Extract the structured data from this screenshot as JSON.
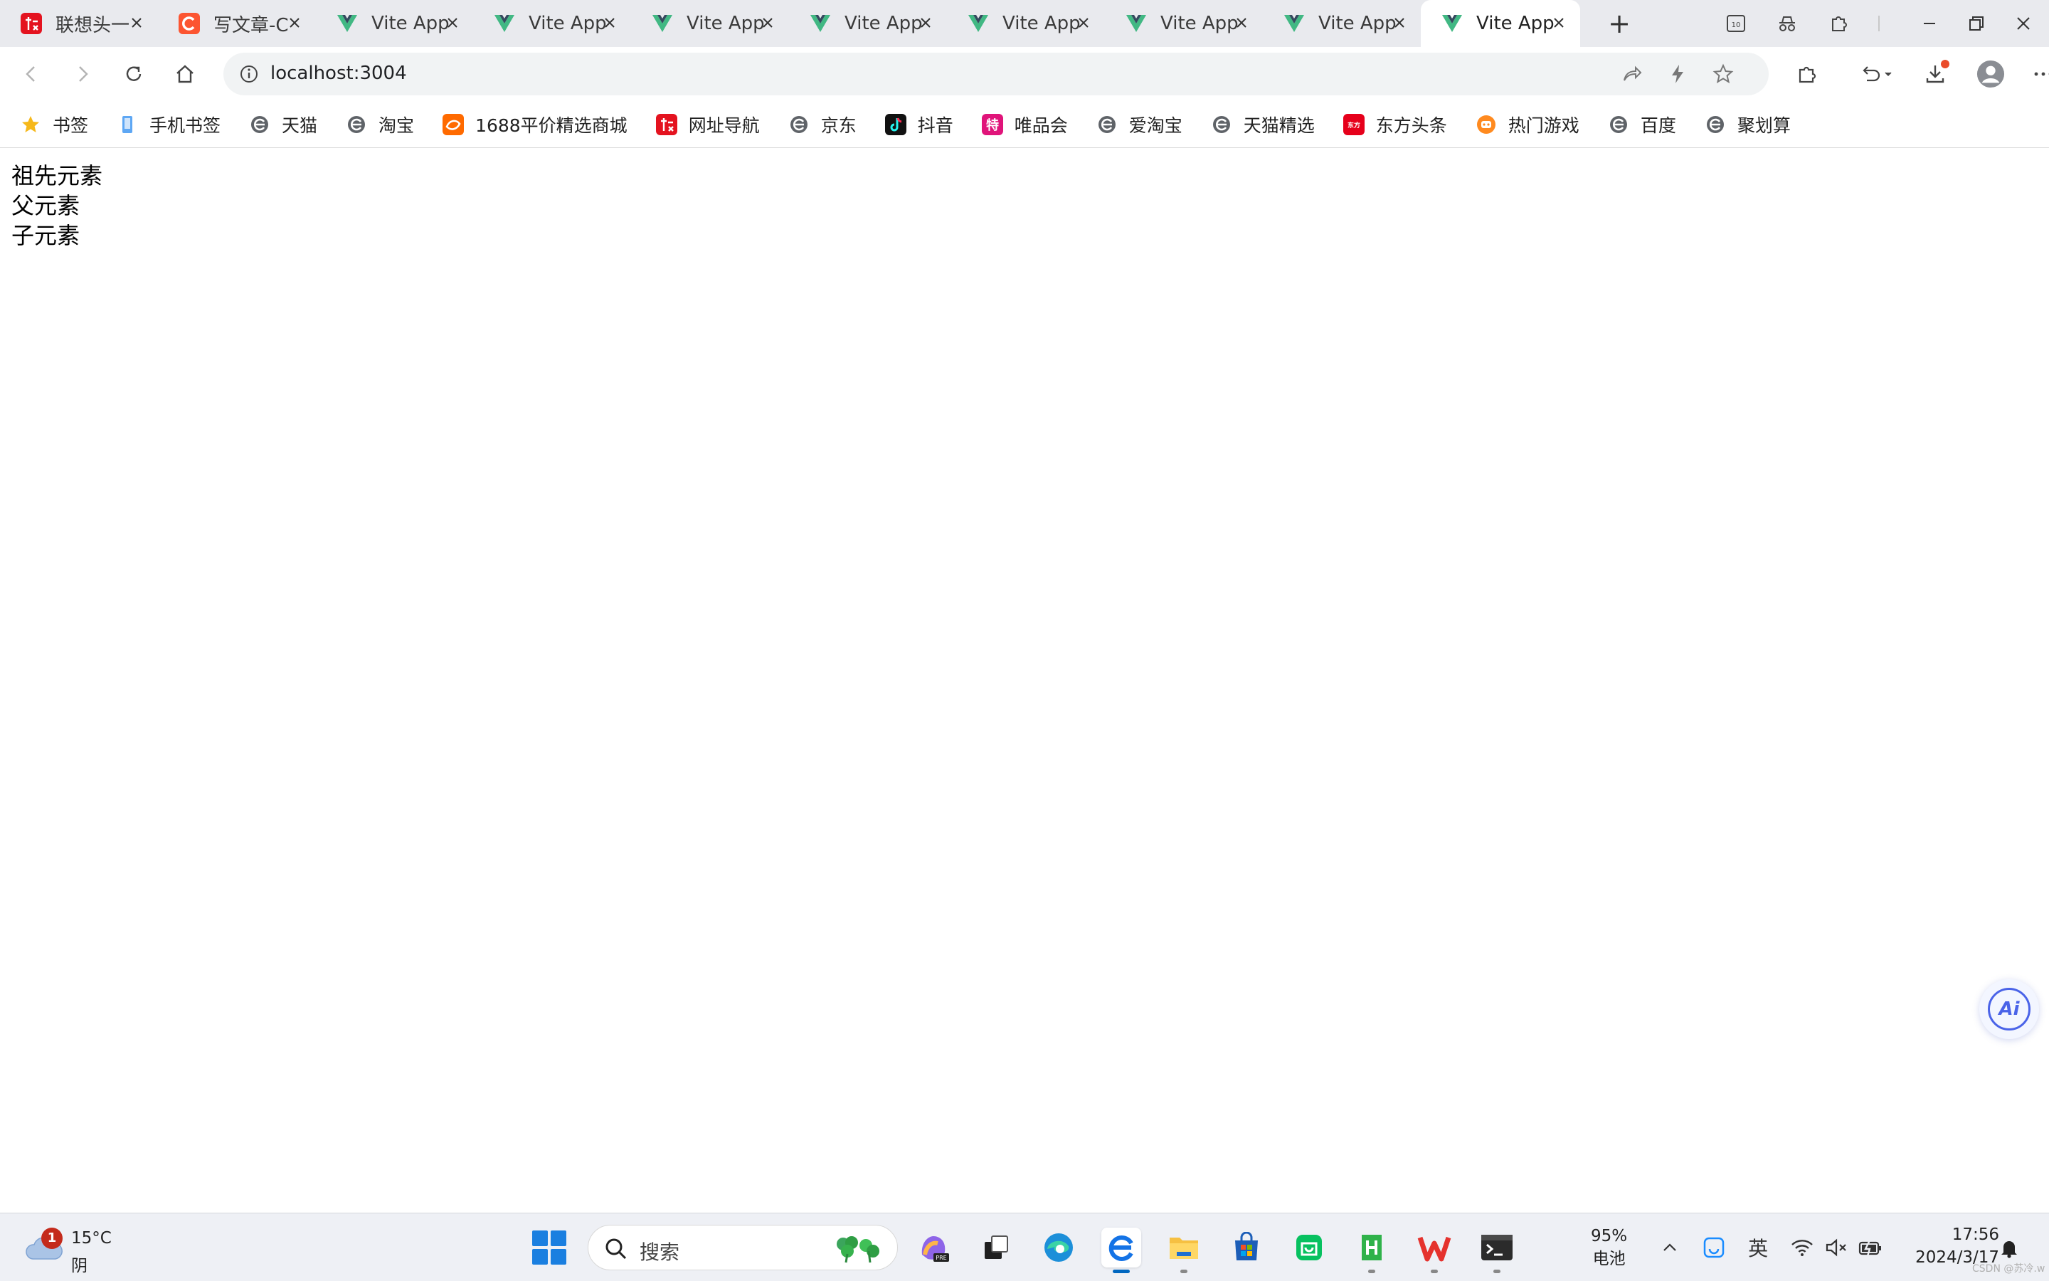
{
  "tabs": [
    {
      "title": "联想头一",
      "favicon": "lenovo-red-icon",
      "active": false
    },
    {
      "title": "写文章-C",
      "favicon": "csdn-icon",
      "active": false
    },
    {
      "title": "Vite App",
      "favicon": "vue-icon",
      "active": false
    },
    {
      "title": "Vite App",
      "favicon": "vue-icon",
      "active": false
    },
    {
      "title": "Vite App",
      "favicon": "vue-icon",
      "active": false
    },
    {
      "title": "Vite App",
      "favicon": "vue-icon",
      "active": false
    },
    {
      "title": "Vite App",
      "favicon": "vue-icon",
      "active": false
    },
    {
      "title": "Vite App",
      "favicon": "vue-icon",
      "active": false
    },
    {
      "title": "Vite App",
      "favicon": "vue-icon",
      "active": false
    },
    {
      "title": "Vite App",
      "favicon": "vue-icon",
      "active": true
    }
  ],
  "tab_icons": {
    "new_tab": "+",
    "tab_count": "10"
  },
  "address_bar": {
    "url": "localhost:3004"
  },
  "bookmarks": [
    {
      "label": "书签",
      "icon": "star-icon"
    },
    {
      "label": "手机书签",
      "icon": "phone-icon"
    },
    {
      "label": "天猫",
      "icon": "browser-e-icon"
    },
    {
      "label": "淘宝",
      "icon": "browser-e-icon"
    },
    {
      "label": "1688平价精选商城",
      "icon": "alibaba-1688-icon"
    },
    {
      "label": "网址导航",
      "icon": "lenovo-red-icon"
    },
    {
      "label": "京东",
      "icon": "browser-e-icon"
    },
    {
      "label": "抖音",
      "icon": "douyin-icon"
    },
    {
      "label": "唯品会",
      "icon": "vip-icon"
    },
    {
      "label": "爱淘宝",
      "icon": "browser-e-icon"
    },
    {
      "label": "天猫精选",
      "icon": "browser-e-icon"
    },
    {
      "label": "东方头条",
      "icon": "dongfang-icon"
    },
    {
      "label": "热门游戏",
      "icon": "game-icon"
    },
    {
      "label": "百度",
      "icon": "browser-e-icon"
    },
    {
      "label": "聚划算",
      "icon": "browser-e-icon"
    }
  ],
  "bookmark_glyphs": {
    "vip": "特",
    "dongfang": "东方"
  },
  "page": {
    "lines": [
      "祖先元素",
      "父元素",
      "子元素"
    ]
  },
  "ai_button": {
    "label": "Ai"
  },
  "taskbar": {
    "weather": {
      "temp": "15°C",
      "condition": "阴",
      "badge": "1"
    },
    "search_label": "搜索",
    "battery_percent": "95%",
    "battery_label": "电池",
    "ime": "英",
    "time": "17:56",
    "date": "2024/3/17"
  },
  "watermark": "CSDN @苏冷.w",
  "colors": {
    "vue_green": "#41b883",
    "vue_dark": "#34495e",
    "accent_blue": "#0067c0",
    "lenovo_red": "#e4131f",
    "csdn_orange": "#fc5531"
  }
}
